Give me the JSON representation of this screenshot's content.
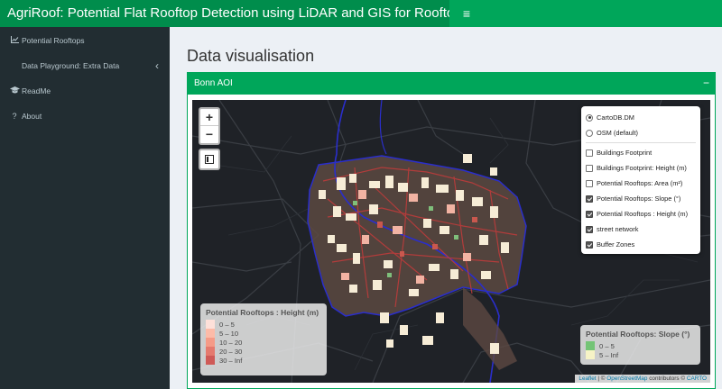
{
  "app": {
    "title": "AgriRoof: Potential Flat Rooftop Detection using LiDAR and GIS for Rooftop Farming",
    "menu_icon": "≡"
  },
  "sidebar": {
    "items": [
      {
        "label": "Potential Rooftops",
        "icon": "chart-icon"
      },
      {
        "label": "Data Playground: Extra Data",
        "icon": "",
        "chevron": "‹"
      },
      {
        "label": "ReadMe",
        "icon": "graduation-cap-icon"
      },
      {
        "label": "About",
        "icon": "question-icon"
      }
    ]
  },
  "main": {
    "title": "Data visualisation",
    "box": {
      "title": "Bonn AOI",
      "collapse": "−"
    }
  },
  "map": {
    "zoom_in": "+",
    "zoom_out": "−",
    "base_layers": [
      {
        "label": "CartoDB.DM",
        "selected": true
      },
      {
        "label": "OSM (default)",
        "selected": false
      }
    ],
    "overlays": [
      {
        "label": "Buildings Footprint",
        "checked": false
      },
      {
        "label": "Buildings Footprint: Height (m)",
        "checked": false
      },
      {
        "label": "Potential Rooftops: Area (m²)",
        "checked": false
      },
      {
        "label": "Potential Rooftops: Slope (°)",
        "checked": true
      },
      {
        "label": "Potential Rooftops : Height (m)",
        "checked": true
      },
      {
        "label": "street network",
        "checked": true
      },
      {
        "label": "Buffer Zones",
        "checked": true
      }
    ],
    "height_legend": {
      "title": "Potential Rooftops : Height (m)",
      "entries": [
        {
          "label": "0 – 5",
          "color": "#fde0d9"
        },
        {
          "label": "5 – 10",
          "color": "#fcbba8"
        },
        {
          "label": "10 – 20",
          "color": "#f59b87"
        },
        {
          "label": "20 – 30",
          "color": "#e57a6e"
        },
        {
          "label": "30 – Inf",
          "color": "#cf5a57"
        }
      ]
    },
    "slope_legend": {
      "title": "Potential Rooftops: Slope (°)",
      "entries": [
        {
          "label": "0 – 5",
          "color": "#74c476"
        },
        {
          "label": "5 – Inf",
          "color": "#f6f3c6"
        }
      ]
    },
    "attribution": {
      "leaflet": "Leaflet",
      "sep": " | © ",
      "osm": "OpenStreetMap",
      "contrib": " contributors © ",
      "carto": "CARTO"
    }
  }
}
